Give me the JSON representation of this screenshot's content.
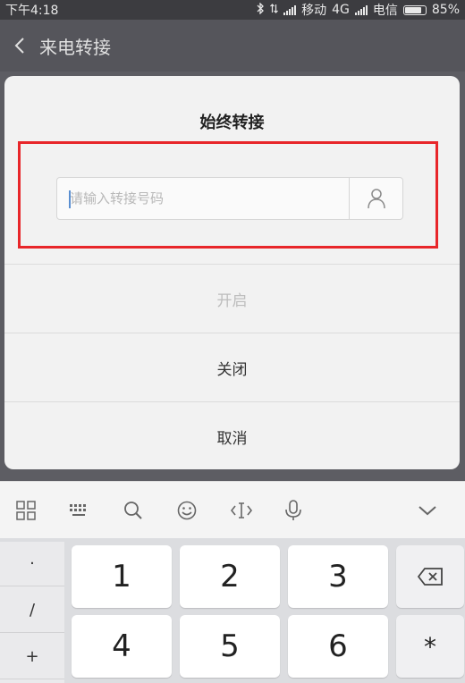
{
  "status_bar": {
    "time": "下午4:18",
    "carrier1": "移动",
    "network": "4G",
    "carrier2": "电信",
    "battery": "85%",
    "battery_level": 0.85
  },
  "header": {
    "title": "来电转接"
  },
  "dialog": {
    "title": "始终转接",
    "input_placeholder": "请输入转接号码",
    "input_value": "",
    "actions": {
      "enable": "开启",
      "disable": "关闭",
      "cancel": "取消"
    }
  },
  "keyboard": {
    "toolbar": [
      "grid-icon",
      "keyboard-icon",
      "search-icon",
      "emoji-icon",
      "cursor-move-icon",
      "microphone-icon",
      "chevron-down-icon"
    ],
    "symbols": [
      "·",
      "/",
      "+"
    ],
    "keys": [
      "1",
      "2",
      "3",
      "4",
      "5",
      "6"
    ],
    "backspace_icon": "backspace-icon",
    "star": "*"
  }
}
